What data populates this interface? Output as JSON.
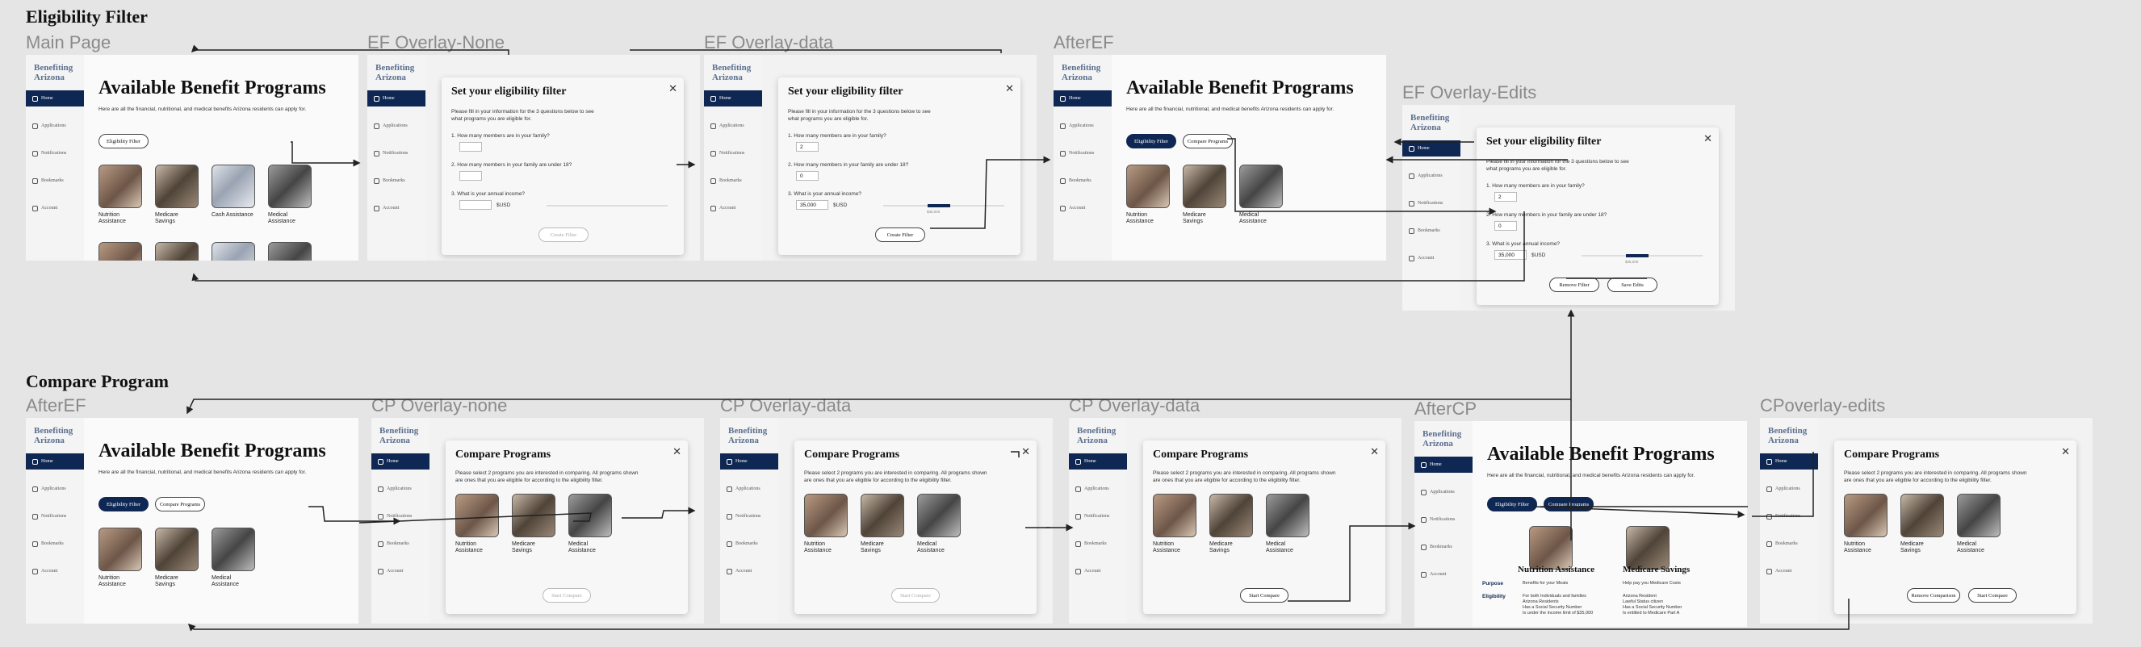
{
  "sections": {
    "eligibility": "Eligibility Filter",
    "compare": "Compare Program"
  },
  "frame_labels": {
    "main_page": "Main Page",
    "ef_none": "EF Overlay-None",
    "ef_data": "EF Overlay-data",
    "after_ef": "AfterEF",
    "ef_edits": "EF Overlay-Edits",
    "cp_after_ef": "AfterEF",
    "cp_none": "CP Overlay-none",
    "cp_data": "CP Overlay-data",
    "cp_data2": "CP Overlay-data",
    "after_cp": "AfterCP",
    "cp_edits": "CPoverlay-edits"
  },
  "app": {
    "logo_line1": "Benefiting",
    "logo_line2": "Arizona",
    "nav": [
      "Home",
      "Applications",
      "Notifications",
      "Bookmarks",
      "Account"
    ],
    "title": "Available Benefit Programs",
    "subtitle": "Here are all the financial, nutritional, and medical benefits Arizona residents can apply for.",
    "eligibility_button": "Eligibility Filter",
    "compare_button": "Compare Programs",
    "programs": [
      "Nutrition Assistance",
      "Medicare Savings",
      "Cash Assistance",
      "Medical Assistance"
    ],
    "program_lines": [
      [
        "Nutrition",
        "Assistance"
      ],
      [
        "Medicare",
        "Savings"
      ],
      [
        "Cash Assistance",
        ""
      ],
      [
        "Medical",
        "Assistance"
      ]
    ]
  },
  "ef_modal": {
    "title": "Set your eligibility filter",
    "intro_1": "Please fill in your information for the 3 questions below to see",
    "intro_2": "what programs you are eligible for.",
    "q1": "1. How many members are in your family?",
    "q2": "2. How many members in your family are under 18?",
    "q3": "3. What is your annual income?",
    "q1_value": "2",
    "q2_value": "0",
    "income_value": "35,000",
    "income_unit": "$USD",
    "slider_mid": "$35,000",
    "create_button": "Create Filter",
    "remove_button": "Remove Filter",
    "save_button": "Save Edits"
  },
  "cp_modal": {
    "title": "Compare Programs",
    "intro_1": "Please select 2 programs you are interested in comparing. All programs shown",
    "intro_2": "are ones that you are eligible for according to the eligibility filter.",
    "start_button": "Start Compare",
    "remove_button": "Remove Comparison"
  },
  "compare_view": {
    "left_title": "Nutrition Assistance",
    "right_title": "Medicare Savings",
    "purpose_label": "Purpose",
    "eligibility_label": "Eligibility",
    "left_purpose": "Benefits for your Meals",
    "right_purpose": "Help pay you Medicare Costs",
    "left_elig": [
      "For both Individuals and families",
      "Arizona Residents",
      "Has a Social Security Number",
      "Is under the income limit of $35,000"
    ],
    "right_elig": [
      "Arizona Resident",
      "Lawful Status citizen",
      "Has a Social Security Number",
      "Is entitled to Medicare Part A"
    ]
  }
}
